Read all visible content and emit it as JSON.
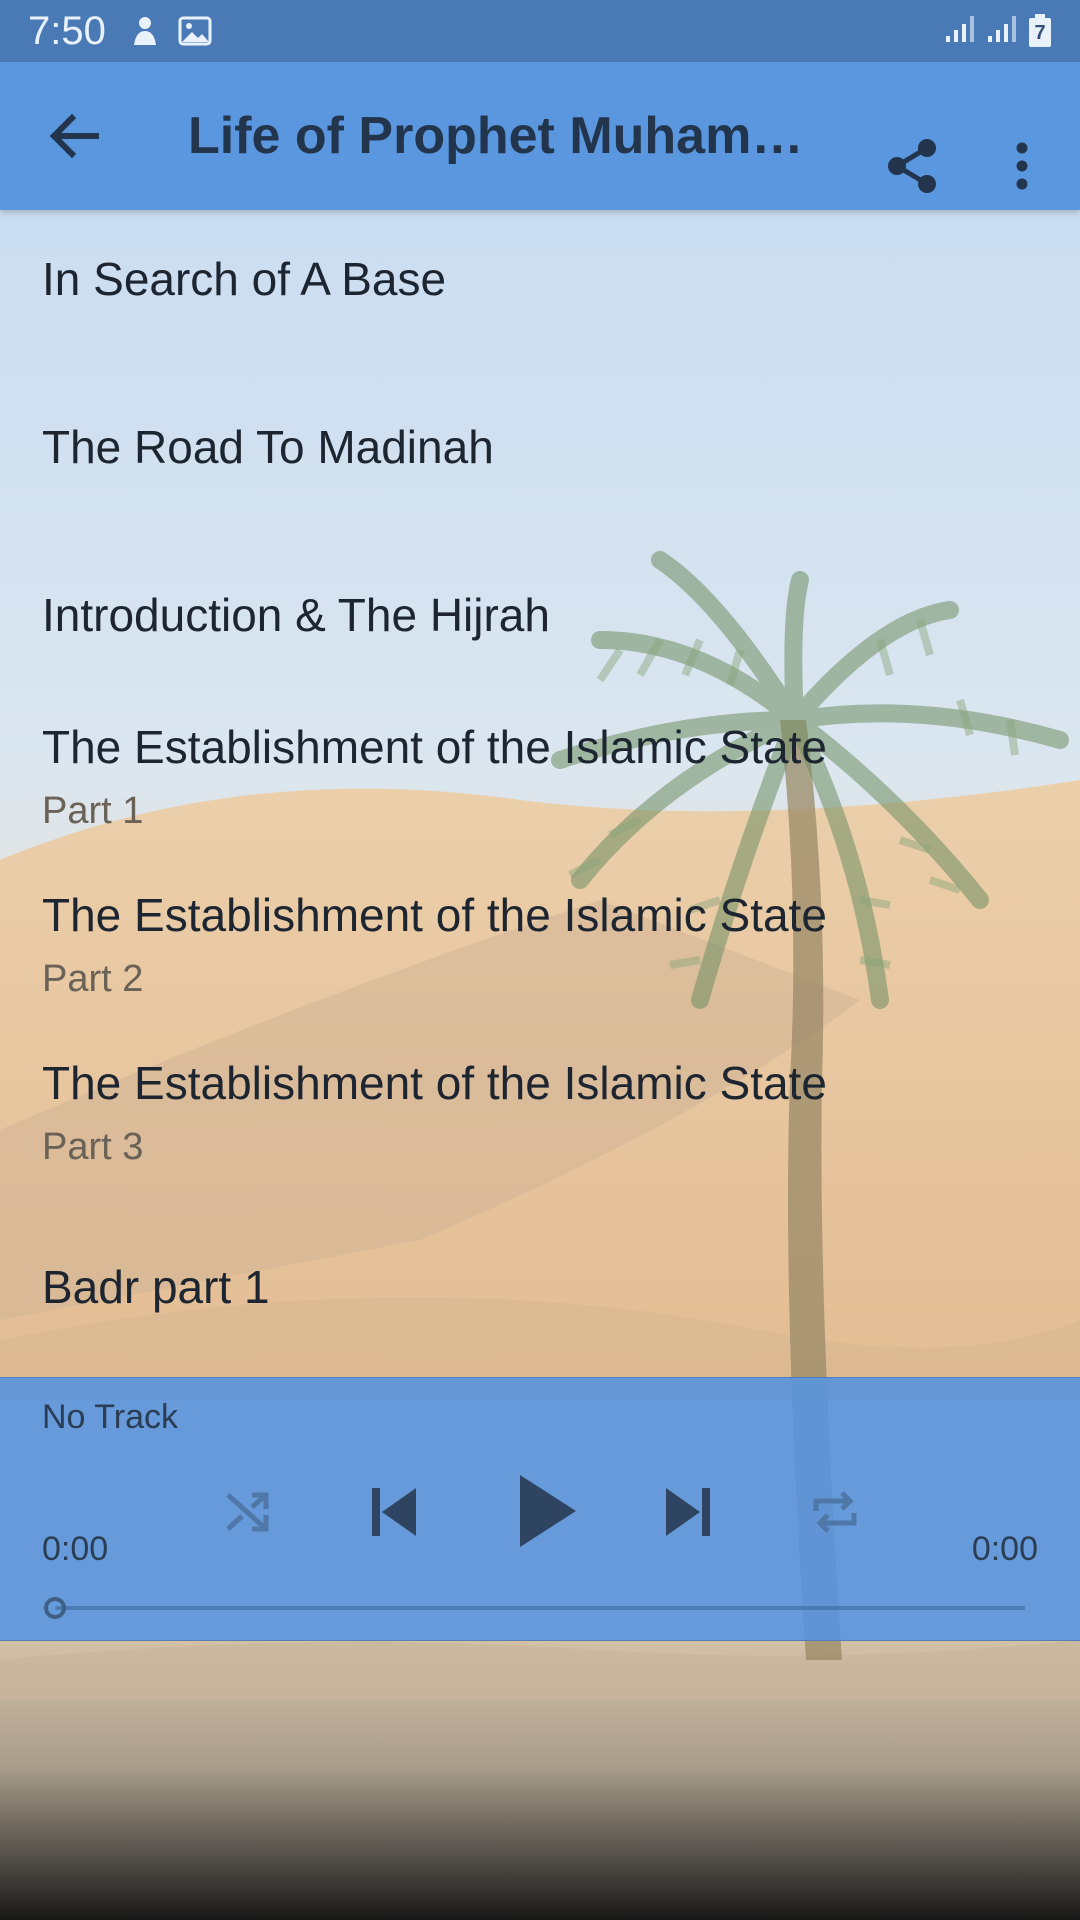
{
  "status_bar": {
    "time": "7:50",
    "battery_level": "7"
  },
  "app_bar": {
    "title": "Life of Prophet Muhammad",
    "back_icon": "arrow-back-icon",
    "share_icon": "share-icon",
    "more_icon": "more-vert-icon"
  },
  "tracks": [
    {
      "title": "In Search of A Base",
      "subtitle": ""
    },
    {
      "title": "The Road To Madinah",
      "subtitle": ""
    },
    {
      "title": "Introduction & The Hijrah",
      "subtitle": ""
    },
    {
      "title": "The Establishment of the Islamic State",
      "subtitle": "Part 1"
    },
    {
      "title": "The Establishment of the Islamic State",
      "subtitle": "Part 2"
    },
    {
      "title": "The Establishment of the Islamic State",
      "subtitle": "Part 3"
    },
    {
      "title": "Badr part 1",
      "subtitle": ""
    }
  ],
  "player": {
    "now_playing": "No Track",
    "elapsed": "0:00",
    "duration": "0:00",
    "progress": 0,
    "controls": [
      "shuffle-icon",
      "skip-previous-icon",
      "play-icon",
      "skip-next-icon",
      "repeat-icon"
    ]
  },
  "colors": {
    "app_bar": "#5b97de",
    "status_bar": "#4a7ab6",
    "player": "#5894de",
    "text_primary": "#1c2530",
    "text_secondary": "#6a6256"
  }
}
